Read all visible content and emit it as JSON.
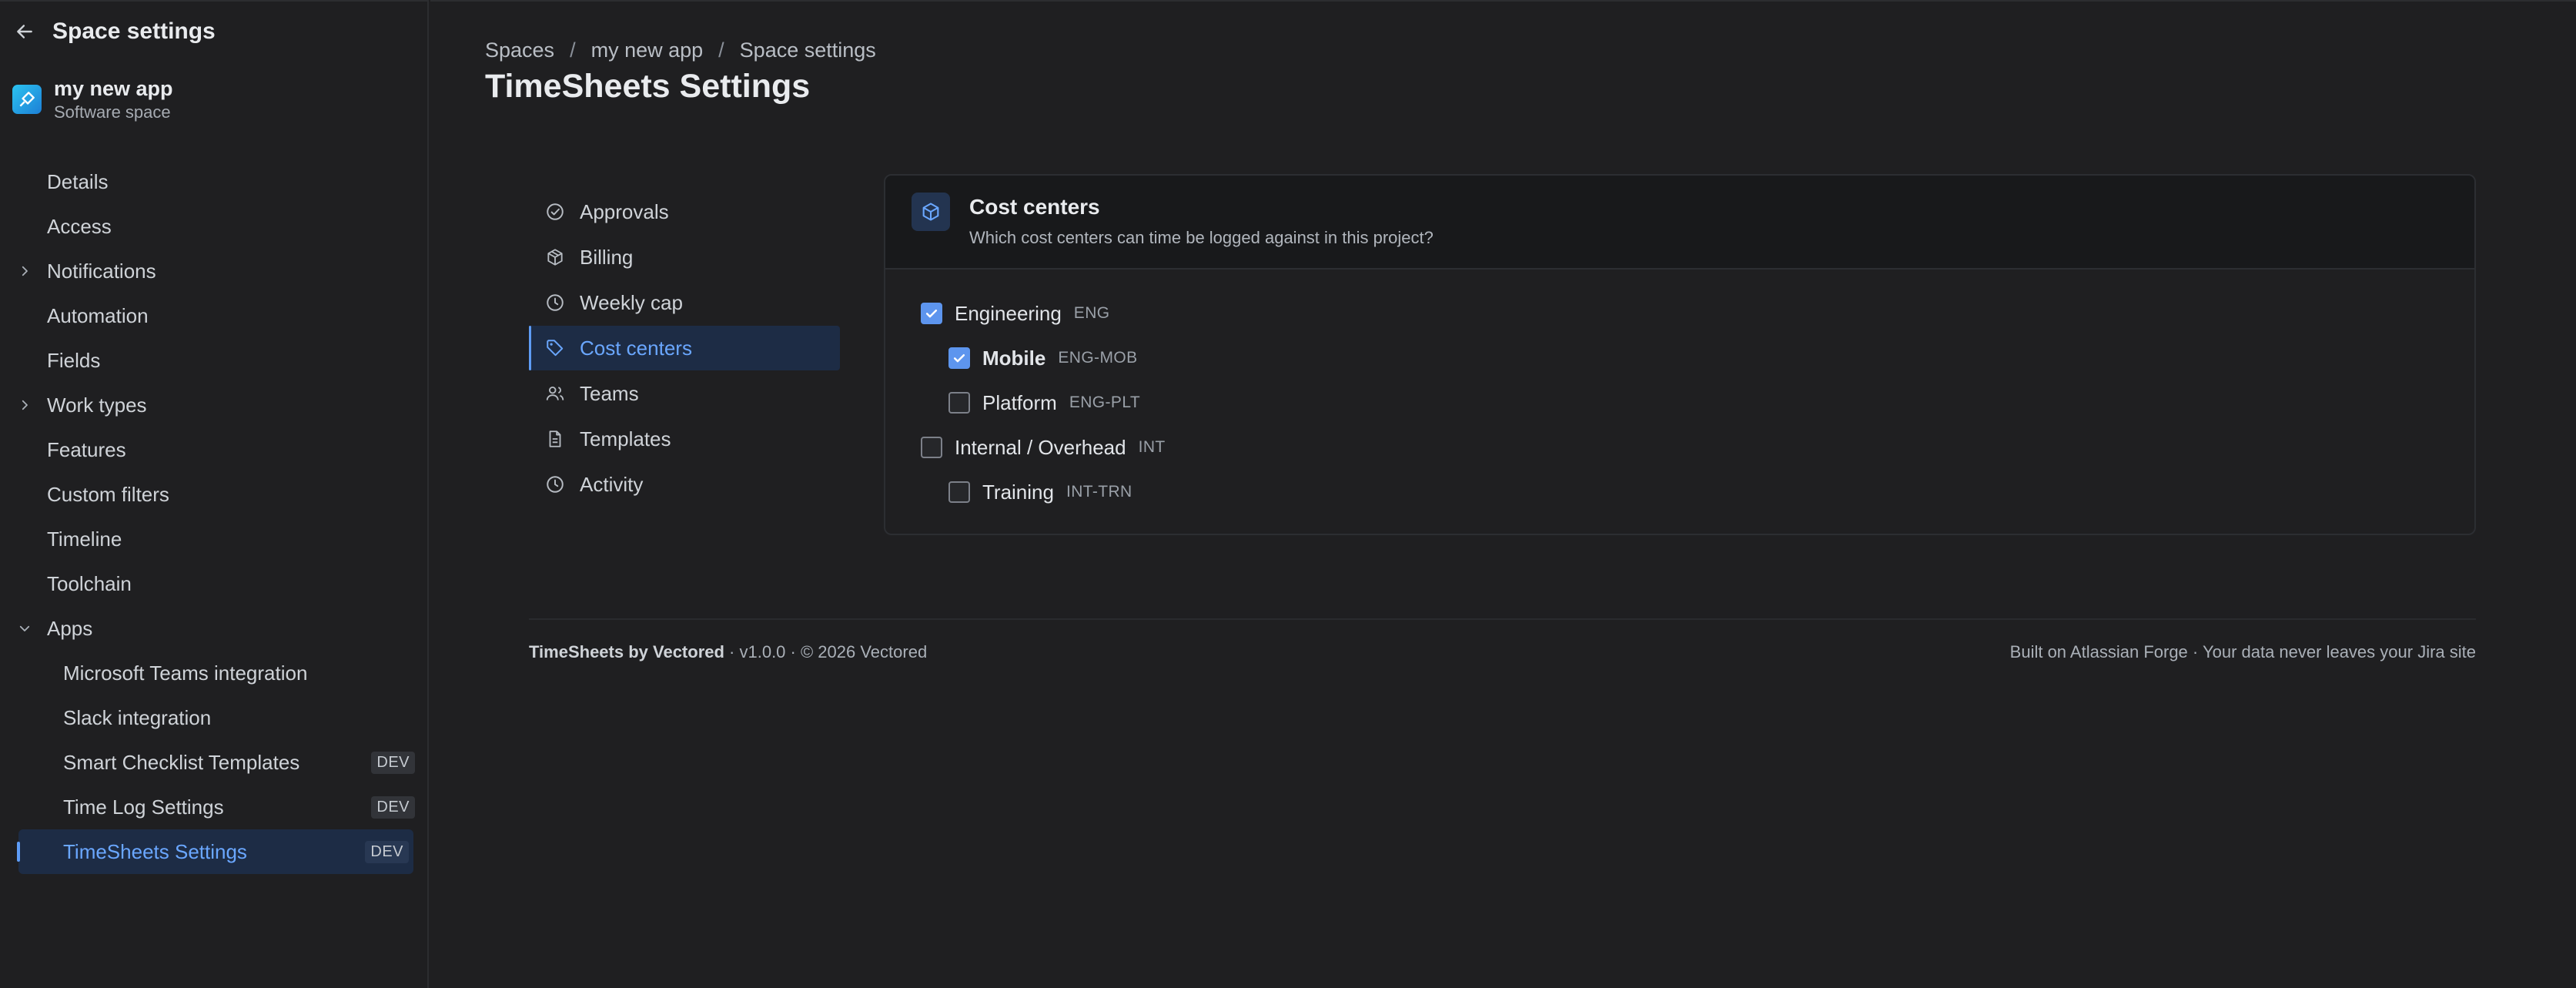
{
  "sidebar": {
    "title": "Space settings",
    "back_icon": "arrow-left-icon",
    "space": {
      "name": "my new app",
      "type": "Software space"
    },
    "items": [
      {
        "label": "Details"
      },
      {
        "label": "Access"
      },
      {
        "label": "Notifications",
        "expandable": true,
        "expanded": false
      },
      {
        "label": "Automation"
      },
      {
        "label": "Fields"
      },
      {
        "label": "Work types",
        "expandable": true,
        "expanded": false
      },
      {
        "label": "Features"
      },
      {
        "label": "Custom filters"
      },
      {
        "label": "Timeline"
      },
      {
        "label": "Toolchain"
      },
      {
        "label": "Apps",
        "expandable": true,
        "expanded": true
      }
    ],
    "apps": [
      {
        "label": "Microsoft Teams integration",
        "badge": ""
      },
      {
        "label": "Slack integration",
        "badge": ""
      },
      {
        "label": "Smart Checklist Templates",
        "badge": "DEV"
      },
      {
        "label": "Time Log Settings",
        "badge": "DEV"
      },
      {
        "label": "TimeSheets Settings",
        "badge": "DEV",
        "active": true
      }
    ]
  },
  "breadcrumb": [
    "Spaces",
    "my new app",
    "Space settings"
  ],
  "breadcrumb_sep": "/",
  "page_title": "TimeSheets Settings",
  "subnav": [
    {
      "label": "Approvals",
      "icon": "check-circle-icon"
    },
    {
      "label": "Billing",
      "icon": "box-icon"
    },
    {
      "label": "Weekly cap",
      "icon": "clock-icon"
    },
    {
      "label": "Cost centers",
      "icon": "tag-icon",
      "active": true
    },
    {
      "label": "Teams",
      "icon": "people-icon"
    },
    {
      "label": "Templates",
      "icon": "document-icon"
    },
    {
      "label": "Activity",
      "icon": "clock-icon"
    }
  ],
  "card": {
    "icon": "cube-icon",
    "title": "Cost centers",
    "subtitle": "Which cost centers can time be logged against in this project?",
    "tree": [
      {
        "name": "Engineering",
        "code": "ENG",
        "checked": true,
        "level": 0
      },
      {
        "name": "Mobile",
        "code": "ENG-MOB",
        "checked": true,
        "level": 1
      },
      {
        "name": "Platform",
        "code": "ENG-PLT",
        "checked": false,
        "level": 1
      },
      {
        "name": "Internal / Overhead",
        "code": "INT",
        "checked": false,
        "level": 0
      },
      {
        "name": "Training",
        "code": "INT-TRN",
        "checked": false,
        "level": 1
      }
    ]
  },
  "footer": {
    "brand": "TimeSheets by Vectored",
    "meta": " · v1.0.0 · © 2026 Vectored",
    "right": "Built on Atlassian Forge · Your data never leaves your Jira site"
  },
  "colors": {
    "accent": "#5e9cf5",
    "active_bg": "#1d2c45",
    "background": "#1f1f21"
  }
}
